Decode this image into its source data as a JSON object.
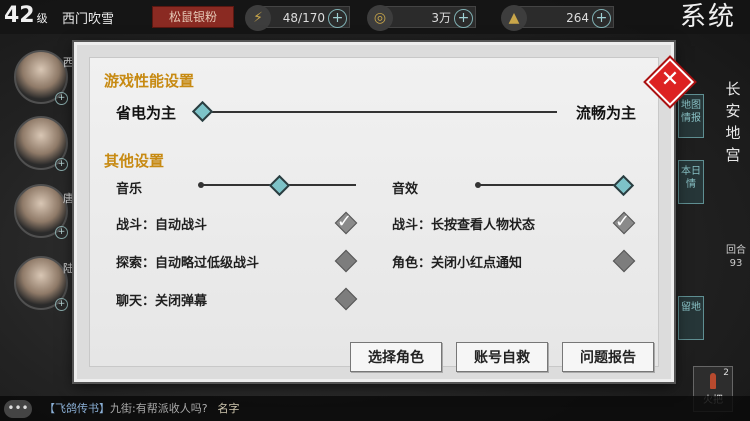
{
  "player": {
    "level": "42",
    "level_unit": "级",
    "name": "西门吹雪",
    "guild": "松鼠银粉"
  },
  "resources": [
    {
      "icon": "lightning-icon",
      "value": "48/170"
    },
    {
      "icon": "coin-icon",
      "value": "3万"
    },
    {
      "icon": "ingot-icon",
      "value": "264"
    }
  ],
  "corner_title": "系统",
  "side_heroes": [
    {
      "tag": "西"
    },
    {
      "tag": ""
    },
    {
      "tag": "唐"
    },
    {
      "tag": "陆"
    }
  ],
  "right": {
    "location": "长安地宫",
    "buttons": [
      "地图情报",
      "本日情",
      "留地"
    ],
    "round_label": "回合",
    "round_value": "93",
    "item_name": "火把",
    "item_count": "2"
  },
  "chat": {
    "channel": "【飞鸽传书】",
    "message": "九街:有帮派收人吗?",
    "name_label": "名字"
  },
  "settings": {
    "performance": {
      "title": "游戏性能设置",
      "left_label": "省电为主",
      "right_label": "流畅为主",
      "value_fraction": 0.0
    },
    "other": {
      "title": "其他设置",
      "music": {
        "label": "音乐",
        "value_fraction": 0.5
      },
      "sfx": {
        "label": "音效",
        "value_fraction": 1.0
      },
      "options": [
        {
          "label": "战斗：自动战斗",
          "checked": true
        },
        {
          "label": "战斗：长按查看人物状态",
          "checked": true
        },
        {
          "label": "探索：自动略过低级战斗",
          "checked": false
        },
        {
          "label": "角色：关闭小红点通知",
          "checked": false
        },
        {
          "label": "聊天：关闭弹幕",
          "checked": false
        }
      ]
    },
    "buttons": {
      "choose_role": "选择角色",
      "account_rescue": "账号自救",
      "issue_report": "问题报告"
    },
    "close_glyph": "✕"
  },
  "colors": {
    "accent_teal": "#7dc3c8",
    "section_title": "#c78a12",
    "close_red": "#dd2222"
  }
}
